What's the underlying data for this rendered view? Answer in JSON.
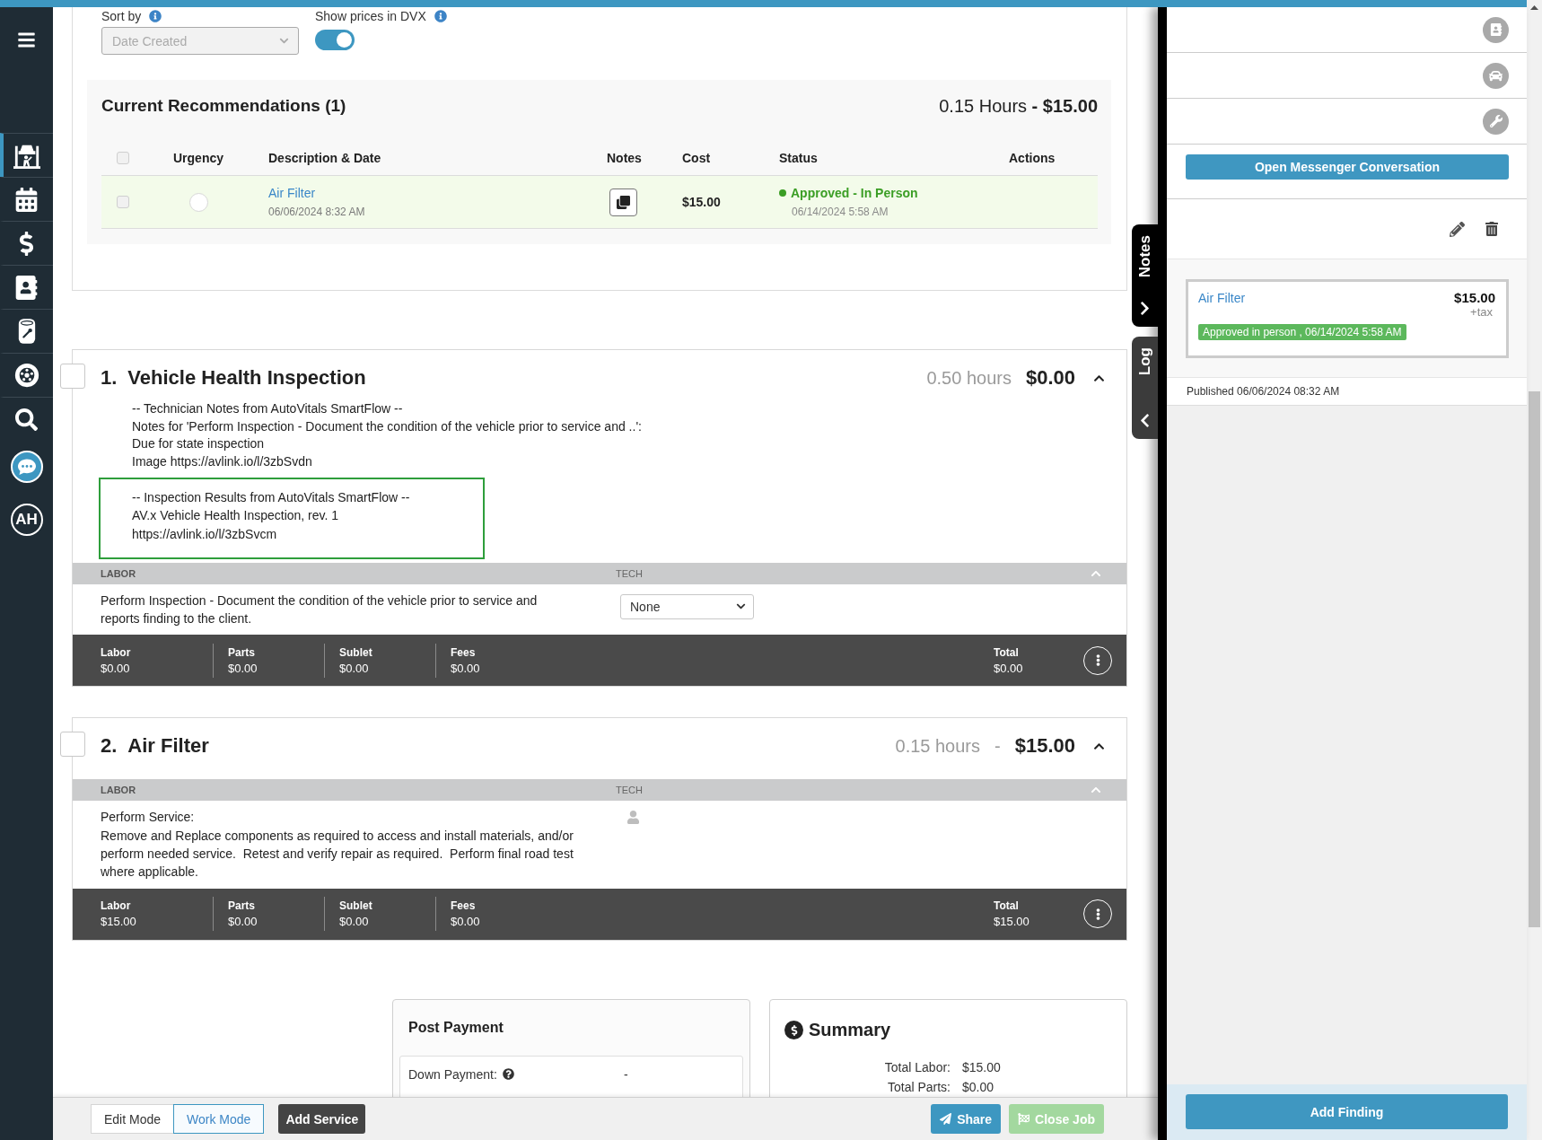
{
  "sidebar": {
    "items": [
      {
        "selected": true
      },
      {
        "selected": false
      },
      {
        "selected": false
      },
      {
        "selected": false
      },
      {
        "selected": false
      },
      {
        "selected": false
      },
      {
        "selected": false
      },
      {
        "selected": false
      }
    ],
    "avatar": "AH"
  },
  "filters": {
    "sort": {
      "label": "Sort by",
      "value": "Date Created",
      "disabled": true
    },
    "prices": {
      "label": "Show prices in DVX",
      "on": true
    }
  },
  "recommendations": {
    "title": "Current Recommendations (1)",
    "summary": "0.15 Hours **- $15.00**",
    "select_all_checked": false,
    "columns": [
      "Urgency",
      "Description & Date",
      "Notes",
      "Cost",
      "Status",
      "Actions"
    ],
    "rows": [
      {
        "checked": false,
        "urgent": false,
        "description": "Air Filter",
        "date": "06/06/2024 8:32 AM",
        "cost": "$15.00",
        "status": {
          "kind": "approved",
          "label": "Approved - In Person",
          "date": "06/14/2024 5:58 AM"
        }
      }
    ]
  },
  "services": [
    {
      "number": "1.",
      "title": "Vehicle Health Inspection",
      "checked": false,
      "expanded": true,
      "hours": "0.50 hours",
      "price": "$0.00",
      "notes": "-- Technician Notes from AutoVitals SmartFlow --\nNotes for 'Perform Inspection - Document the condition of the vehicle prior to service and ..':\nDue for state inspection\nImage https://avlink.io/l/3zbSvdn",
      "inspection_results": "-- Inspection Results from AutoVitals SmartFlow --\nAV.x Vehicle Health Inspection, rev. 1\nhttps://avlink.io/l/3zbSvcm",
      "labor": {
        "header": "LABOR",
        "tech_header": "TECH",
        "expanded": true,
        "description": "Perform Inspection - Document the condition of the vehicle prior to service and reports finding to the client.",
        "tech": {
          "kind": "select",
          "value": "None"
        }
      },
      "totals": [
        {
          "label": "Labor",
          "value": "$0.00"
        },
        {
          "label": "Parts",
          "value": "$0.00"
        },
        {
          "label": "Sublet",
          "value": "$0.00"
        },
        {
          "label": "Fees",
          "value": "$0.00"
        },
        {
          "label": "Total",
          "value": "$0.00"
        }
      ]
    },
    {
      "number": "2.",
      "title": "Air Filter",
      "checked": false,
      "expanded": true,
      "hours": "0.15 hours",
      "separator": "-",
      "price": "$15.00",
      "labor": {
        "header": "LABOR",
        "tech_header": "TECH",
        "expanded": true,
        "description": "Perform Service:\nRemove and Replace components as required to access and install materials, and/or perform needed service.  Retest and verify repair as required.  Perform final road test where applicable.",
        "tech": {
          "kind": "unassigned"
        }
      },
      "totals": [
        {
          "label": "Labor",
          "value": "$15.00"
        },
        {
          "label": "Parts",
          "value": "$0.00"
        },
        {
          "label": "Sublet",
          "value": "$0.00"
        },
        {
          "label": "Fees",
          "value": "$0.00"
        },
        {
          "label": "Total",
          "value": "$15.00"
        }
      ]
    }
  ],
  "payment": {
    "title": "Post Payment",
    "down_payment": {
      "label": "Down Payment:",
      "value": "-"
    }
  },
  "summary": {
    "title": "Summary",
    "lines": [
      {
        "label": "Total Labor:",
        "value": "$15.00"
      },
      {
        "label": "Total Parts:",
        "value": "$0.00"
      }
    ]
  },
  "footer": {
    "modes": [
      {
        "label": "Edit Mode",
        "selected": false
      },
      {
        "label": "Work Mode",
        "selected": true
      }
    ],
    "add_service": "Add Service",
    "share": "Share",
    "close_job": {
      "label": "Close Job",
      "disabled": true
    }
  },
  "side_tabs": [
    {
      "label": "Notes",
      "selected": true
    },
    {
      "label": "Log",
      "selected": false
    }
  ],
  "right_panel": {
    "messenger_button": "Open Messenger Conversation",
    "finding": {
      "title": "Air Filter",
      "price": "$15.00",
      "tax": "+tax",
      "badge": "Approved in person , 06/14/2024 5:58 AM"
    },
    "published": "Published 06/06/2024 08:32 AM",
    "add_finding": "Add Finding"
  }
}
